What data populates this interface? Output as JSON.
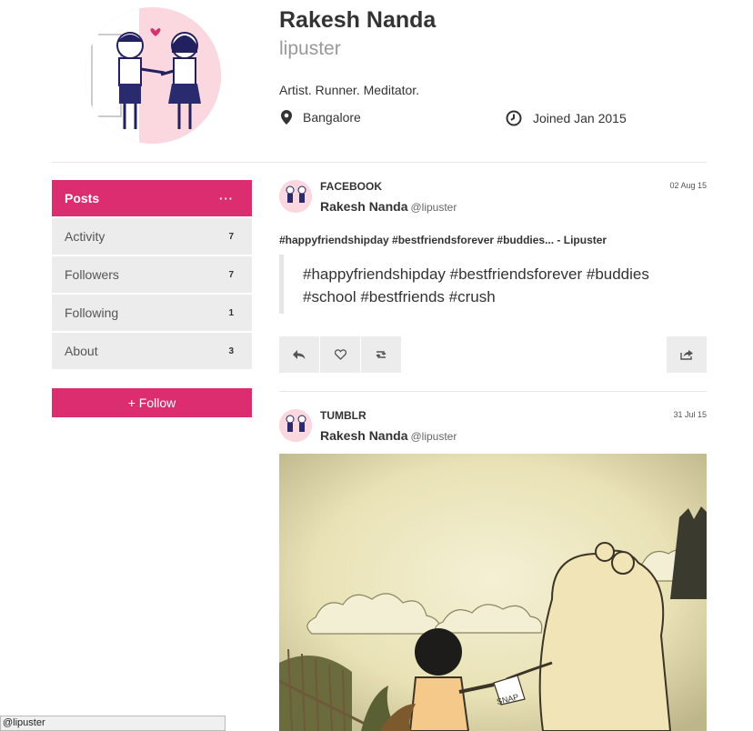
{
  "profile": {
    "name": "Rakesh Nanda",
    "handle": "lipuster",
    "bio": "Artist. Runner. Meditator.",
    "location": "Bangalore",
    "joined": "Joined Jan 2015",
    "location_icon": "map-pin-icon",
    "joined_icon": "clock-icon"
  },
  "nav": {
    "items": [
      {
        "label": "Posts",
        "count": "···",
        "active": true
      },
      {
        "label": "Activity",
        "count": "7"
      },
      {
        "label": "Followers",
        "count": "7"
      },
      {
        "label": "Following",
        "count": "1"
      },
      {
        "label": "About",
        "count": "3"
      }
    ],
    "follow_label": "+ Follow"
  },
  "posts": [
    {
      "source": "FACEBOOK",
      "date": "02 Aug 15",
      "author": "Rakesh Nanda",
      "handle": "@lipuster",
      "title": "#happyfriendshipday #bestfriendsforever #buddies... - Lipuster",
      "quote_line1": "#happyfriendshipday #bestfriendsforever #buddies",
      "quote_line2": "#school #bestfriends #crush"
    },
    {
      "source": "TUMBLR",
      "date": "31 Jul 15",
      "author": "Rakesh Nanda",
      "handle": "@lipuster",
      "image_text": "SNAP"
    }
  ],
  "actions": [
    "reply-icon",
    "heart-icon",
    "retweet-icon",
    "share-icon"
  ],
  "status_bar": "@lipuster",
  "colors": {
    "accent": "#dc2d71",
    "nav_bg": "#ececec",
    "avatar_bg": "#f7c9d2"
  }
}
